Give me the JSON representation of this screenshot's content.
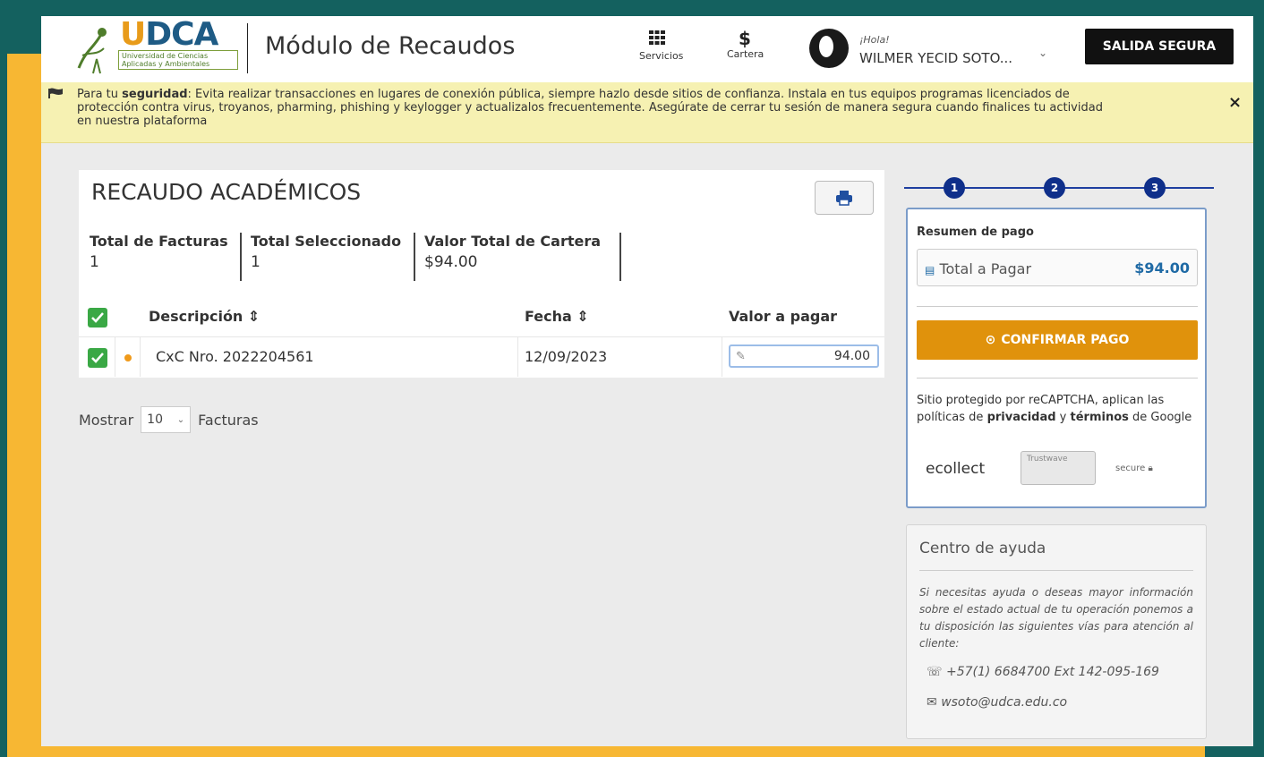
{
  "header": {
    "logo_text_u": "U",
    "logo_text_rest": "DCA",
    "logo_subtitle": "Universidad de Ciencias Aplicadas y Ambientales",
    "module_title": "Módulo de Recaudos",
    "nav": [
      {
        "label": "Servicios",
        "icon": "grid-icon"
      },
      {
        "label": "Cartera",
        "icon": "dollar-icon"
      }
    ],
    "greeting": "¡Hola!",
    "username": "WILMER YECID SOTO...",
    "logout_label": "SALIDA SEGURA"
  },
  "banner": {
    "lead": "Para tu",
    "bold": "seguridad",
    "text": ": Evita realizar transacciones en lugares de conexión pública, siempre hazlo desde sitios de confianza. Instala en tus equipos programas licenciados de protección contra virus, troyanos, pharming, phishing y keylogger y actualizalos frecuentemente. Asegúrate de cerrar tu sesión de manera segura cuando finalices tu actividad en nuestra plataforma",
    "close": "×"
  },
  "panel": {
    "title": "RECAUDO ACADÉMICOS",
    "stats": [
      {
        "label": "Total de Facturas",
        "value": "1"
      },
      {
        "label": "Total Seleccionado",
        "value": "1"
      },
      {
        "label": "Valor Total de Cartera",
        "value": "$94.00"
      }
    ],
    "columns": {
      "description": "Descripción ⇕",
      "date": "Fecha ⇕",
      "amount": "Valor a pagar"
    },
    "rows": [
      {
        "description": "CxC Nro. 2022204561",
        "date": "12/09/2023",
        "amount": "94.00"
      }
    ],
    "pager": {
      "show": "Mostrar",
      "selected": "10",
      "suffix": "Facturas"
    }
  },
  "stepper": {
    "steps": [
      "1",
      "2",
      "3"
    ]
  },
  "summary": {
    "title": "Resumen de pago",
    "total_label": "Total a Pagar",
    "total_amount": "$94.00",
    "confirm_label": "CONFIRMAR PAGO",
    "recaptcha_lead": "Sitio protegido por reCAPTCHA, aplican las políticas de",
    "privacy": "privacidad",
    "and": "y",
    "terms": "términos",
    "recaptcha_tail": "de Google",
    "badge_ecollect": "ecollect",
    "badge_trust": "Trustwave",
    "badge_secure": "secure"
  },
  "help": {
    "title": "Centro de ayuda",
    "text": "Si necesitas ayuda o deseas mayor información sobre el estado actual de tu operación ponemos a tu disposición las siguientes vías para atención al cliente:",
    "phone": "+57(1) 6684700 Ext 142-095-169",
    "email": "wsoto@udca.edu.co"
  },
  "colors": {
    "brand_blue": "#1e5b85",
    "brand_orange": "#e89b1a",
    "confirm_orange": "#e0920c",
    "check_green": "#3aa845",
    "banner_yellow": "#f6f1b2",
    "outer_teal": "#14615f",
    "frame_yellow": "#f7b733"
  }
}
